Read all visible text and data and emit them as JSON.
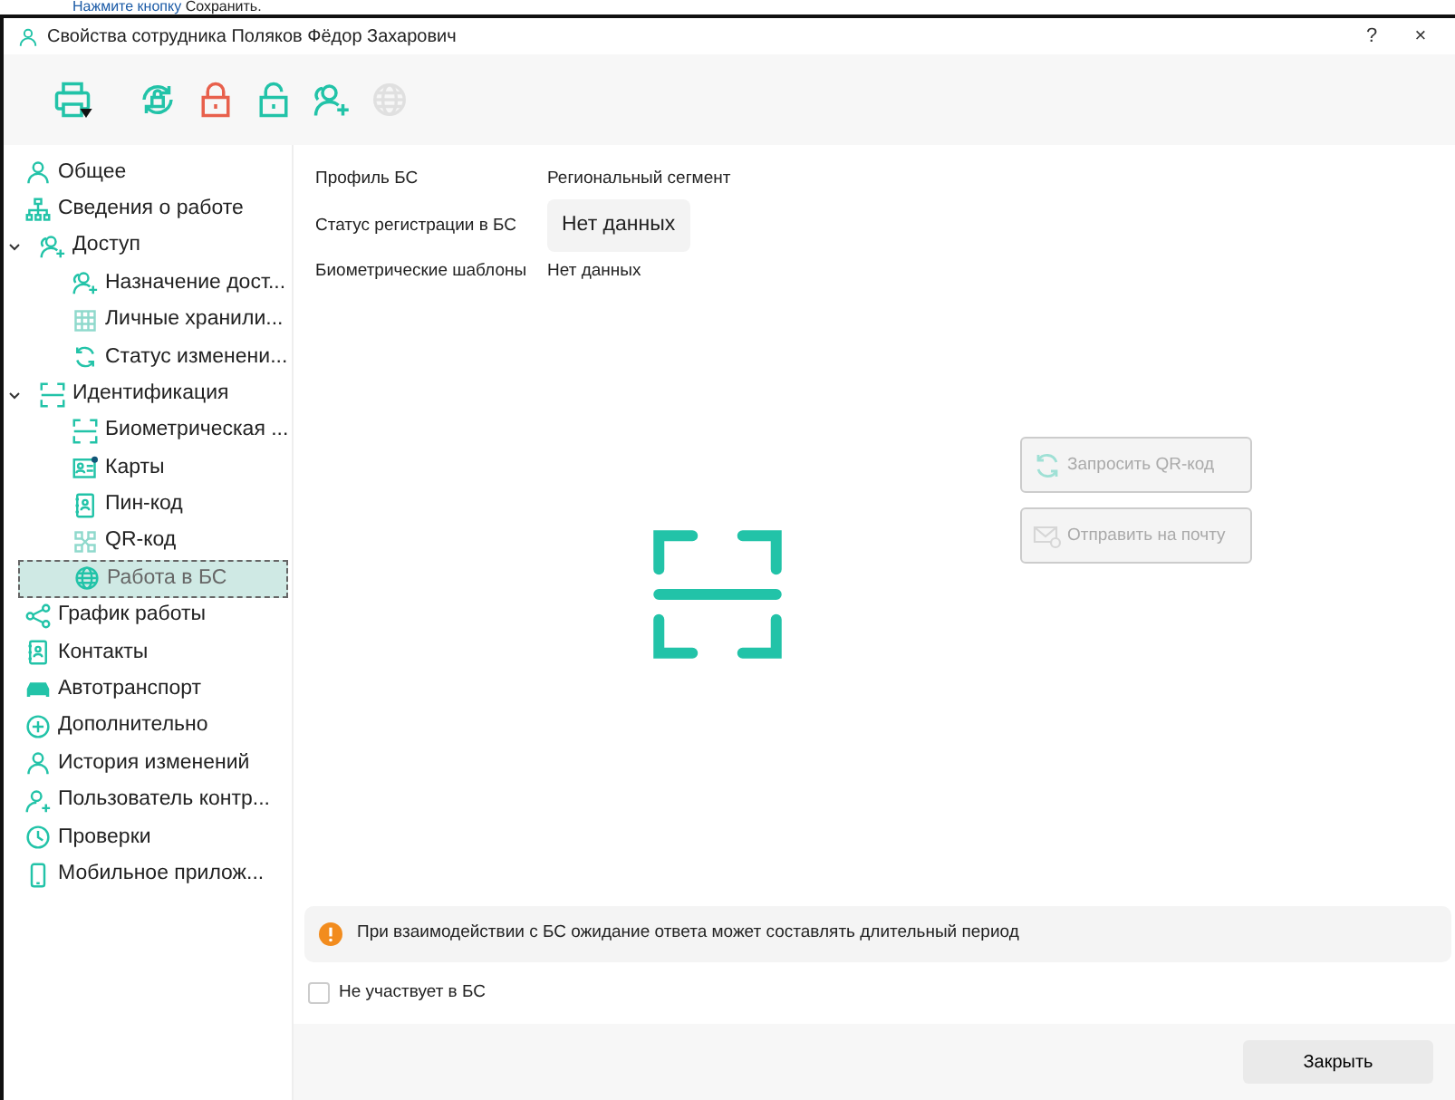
{
  "page_caption": {
    "link": "Нажмите кнопку",
    "text": "Сохранить."
  },
  "window": {
    "title": "Свойства сотрудника Поляков Фёдор Захарович",
    "help": "?",
    "close": "×"
  },
  "toolbar": [
    {
      "disabled": false,
      "dropdown": true
    },
    {
      "disabled": false,
      "dropdown": false
    },
    {
      "disabled": false,
      "dropdown": false
    },
    {
      "disabled": false,
      "dropdown": false
    },
    {
      "disabled": false,
      "dropdown": false
    },
    {
      "disabled": true,
      "dropdown": false
    }
  ],
  "sidebar": {
    "items": [
      {
        "label": "Общее",
        "selected": false
      },
      {
        "label": "Сведения о работе",
        "selected": false
      },
      {
        "label": "Доступ",
        "selected": false,
        "expanded": true,
        "children": [
          {
            "label": "Назначение дост...",
            "selected": false
          },
          {
            "label": "Личные хранили...",
            "selected": false
          },
          {
            "label": "Статус изменени...",
            "selected": false
          }
        ]
      },
      {
        "label": "Идентификация",
        "selected": false,
        "expanded": true,
        "children": [
          {
            "label": "Биометрическая ...",
            "selected": false
          },
          {
            "label": "Карты",
            "selected": false
          },
          {
            "label": "Пин-код",
            "selected": false
          },
          {
            "label": "QR-код",
            "selected": false
          },
          {
            "label": "Работа в БС",
            "selected": true
          }
        ]
      },
      {
        "label": "График работы",
        "selected": false
      },
      {
        "label": "Контакты",
        "selected": false
      },
      {
        "label": "Автотранспорт",
        "selected": false
      },
      {
        "label": "Дополнительно",
        "selected": false
      },
      {
        "label": "История изменений",
        "selected": false
      },
      {
        "label": "Пользователь контр...",
        "selected": false
      },
      {
        "label": "Проверки",
        "selected": false
      },
      {
        "label": "Мобильное прилож...",
        "selected": false
      }
    ]
  },
  "fields": [
    {
      "label": "Профиль БС",
      "value": "Региональный сегмент",
      "kind": "text"
    },
    {
      "label": "Статус регистрации в БС",
      "value": "Нет данных",
      "kind": "chip"
    },
    {
      "label": "Биометрические шаблоны",
      "value": "Нет данных",
      "kind": "text"
    }
  ],
  "actions": [
    {
      "label": "Запросить QR-код",
      "disabled": true
    },
    {
      "label": "Отправить на почту",
      "disabled": true
    }
  ],
  "notice": "При взаимодействии с БС ожидание ответа может составлять длительный период",
  "not_participating": {
    "label": "Не участвует в БС",
    "checked": false
  },
  "footer": {
    "close_button": "Закрыть"
  }
}
